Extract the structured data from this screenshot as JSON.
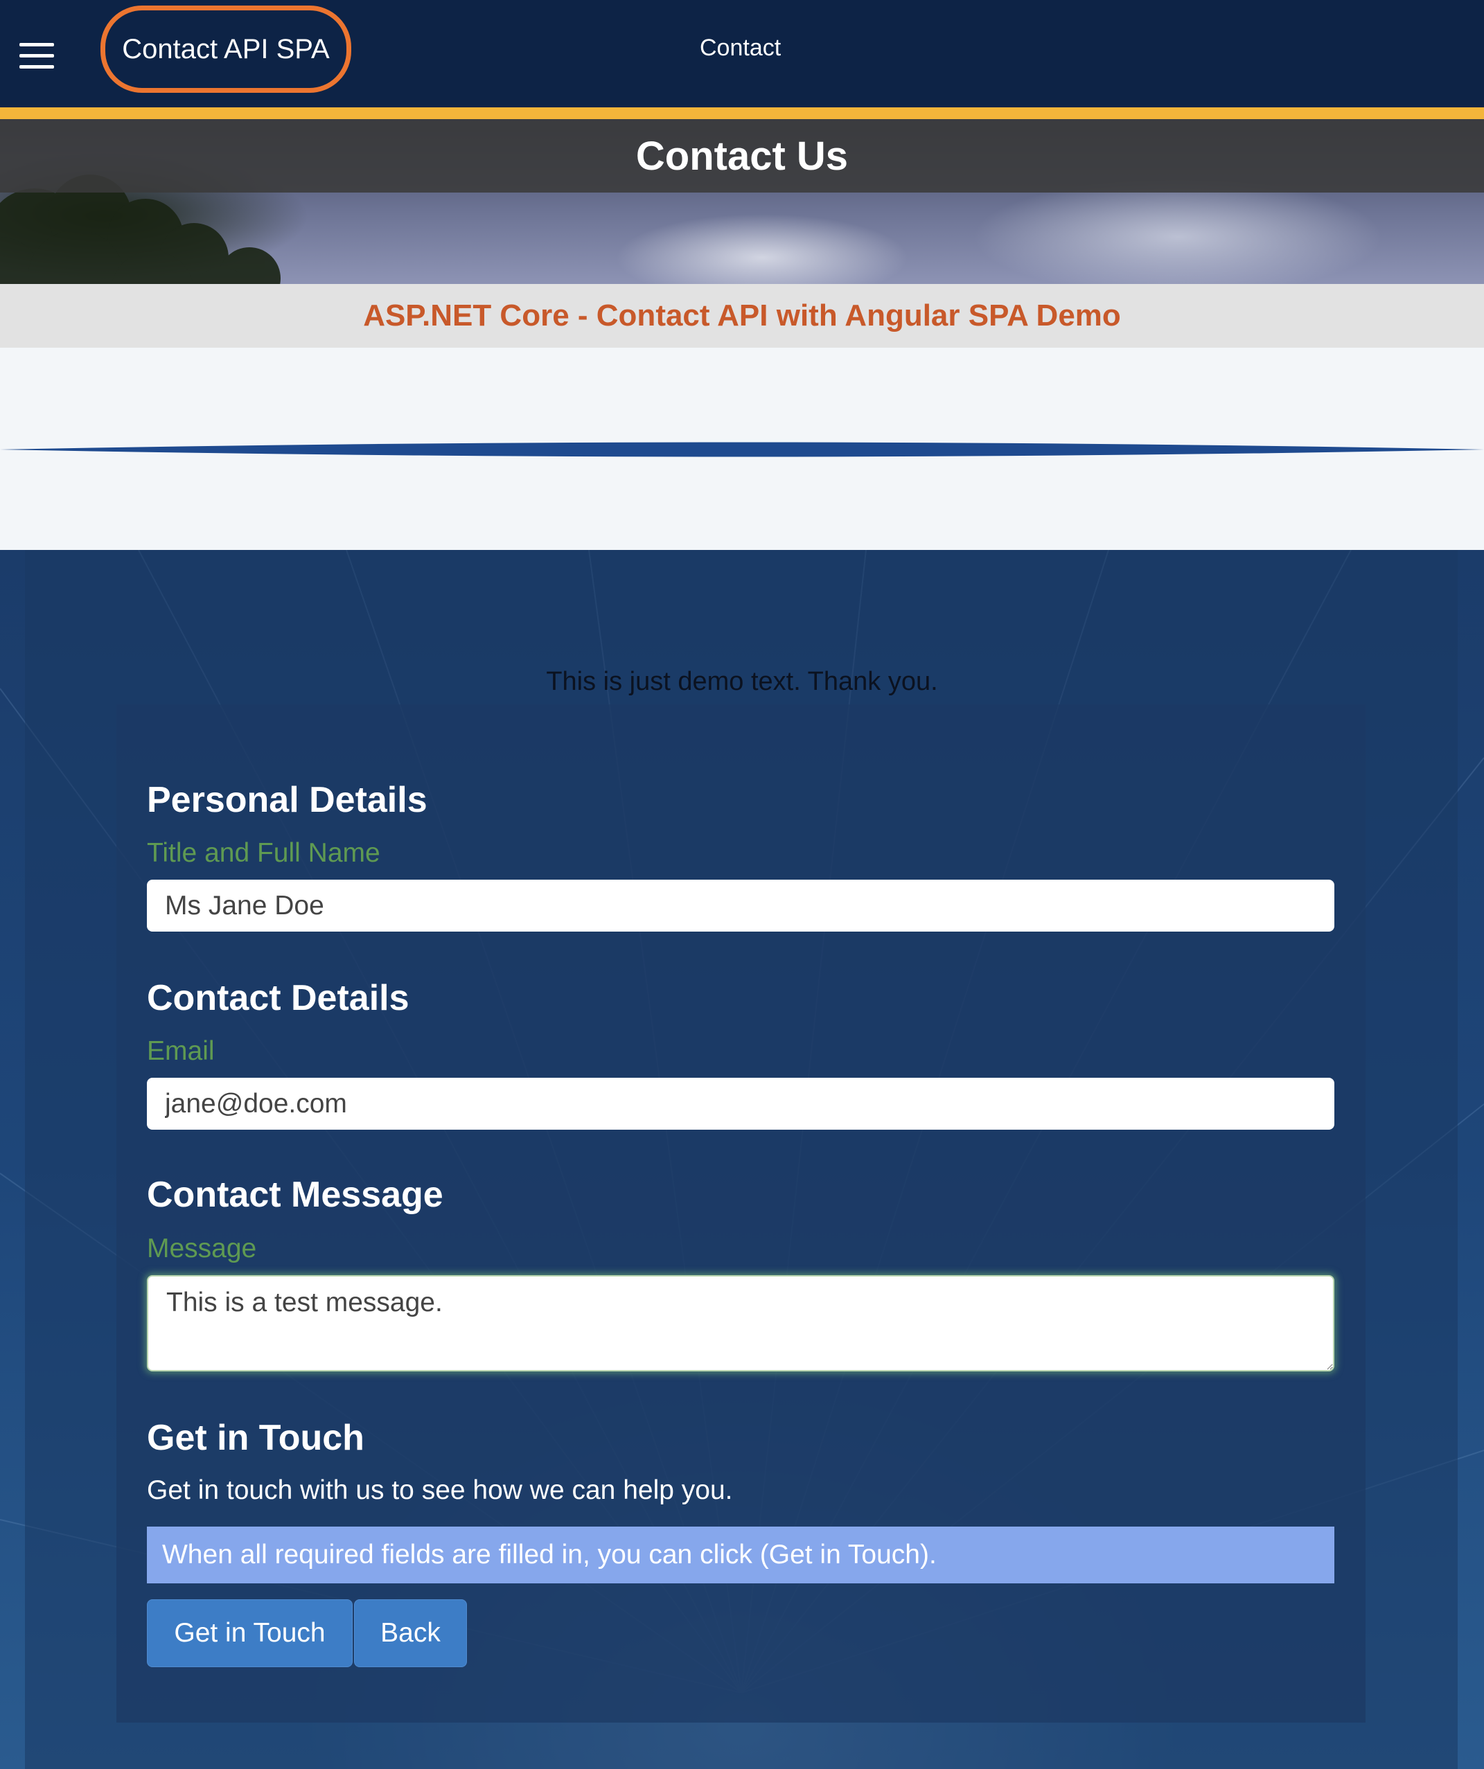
{
  "navbar": {
    "menu_icon": "hamburger-menu-icon",
    "brand": "Contact API SPA",
    "links": [
      "Contact"
    ]
  },
  "hero": {
    "title": "Contact Us"
  },
  "subtitle": "ASP.NET Core - Contact API with Angular SPA Demo",
  "main": {
    "demo_text": "This is just demo text. Thank you."
  },
  "form": {
    "personal": {
      "heading": "Personal Details",
      "label": "Title and Full Name",
      "value": "Ms Jane Doe"
    },
    "contact": {
      "heading": "Contact Details",
      "label": "Email",
      "value": "jane@doe.com"
    },
    "message": {
      "heading": "Contact Message",
      "label": "Message",
      "value": "This is a test message."
    },
    "get_in_touch": {
      "heading": "Get in Touch",
      "body": "Get in touch with us to see how we can help you.",
      "info": "When all required fields are filled in, you can click (Get in Touch)."
    },
    "buttons": {
      "submit": "Get in Touch",
      "back": "Back"
    }
  },
  "colors": {
    "navbar_bg": "#0d2346",
    "brand_outline": "#ec7530",
    "accent_bar": "#f4b53a",
    "subtitle_text": "#c8592a",
    "divider": "#1e4a8f",
    "label_green": "#5f9a52",
    "info_box": "#86a7ec",
    "button": "#3d7dc6"
  }
}
